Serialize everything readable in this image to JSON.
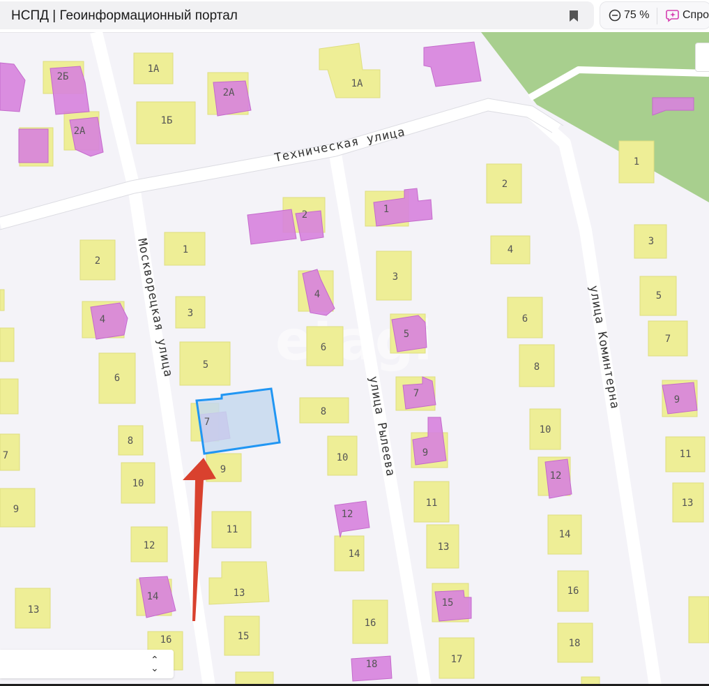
{
  "header": {
    "title": "НСПД | Геоинформационный портал",
    "zoom": "75 %",
    "ask_label": "Спро"
  },
  "icons": {
    "bookmark": "bookmark-icon",
    "zoom": "zoom-out-icon",
    "ask": "ai-assistant-icon",
    "select": "chevron-up-down-icon",
    "arrow": "arrow-up-icon"
  },
  "colors": {
    "building": "#eeee96",
    "parcel": "#d782dd",
    "selection_fill": "#c5d8ef",
    "selection_stroke": "#2196f3",
    "arrow": "#d9412e",
    "forest": "#a8cf8e",
    "road": "#ffffff"
  },
  "map": {
    "watermark": "etagi",
    "streets": {
      "tekhnicheskaya": "Техническая улица",
      "moskvoretskaya": "Москворецкая улица",
      "ryleeva": "улица Рылеева",
      "kominterna": "улица Коминтерна"
    },
    "house_numbers": {
      "h1A_left": "1А",
      "h2B": "2Б",
      "h1B": "1Б",
      "h2A_mid": "2А",
      "h2A_left": "2А",
      "h1A_right": "1А",
      "h2_mosk_w": "2",
      "h4_mosk_w": "4",
      "h6_mosk_w": "6",
      "h8_mosk_w": "8",
      "h10_mosk_w": "10",
      "h12_mosk_w": "12",
      "h14_mosk_w": "14",
      "h16_mosk_w": "16",
      "h9_far_w": "9",
      "h7_far_w": "7",
      "h13_far_w": "13",
      "h1_mosk_e": "1",
      "h3_mosk_e": "3",
      "h5_mosk_e": "5",
      "h7_mosk_e": "7",
      "h9_mosk_e": "9",
      "h11_mosk_e": "11",
      "h13_mosk_e": "13",
      "h15_mosk_e": "15",
      "h2_ryl_w": "2",
      "h4_ryl_w": "4",
      "h6_ryl_w": "6",
      "h8_ryl_w": "8",
      "h10_ryl_w": "10",
      "h12_ryl_w": "12",
      "h14_ryl_w": "14",
      "h16_ryl_w": "16",
      "h18_ryl_w": "18",
      "h1_ryl_e": "1",
      "h3_ryl_e": "3",
      "h5_ryl_e": "5",
      "h7_ryl_e": "7",
      "h9_ryl_e": "9",
      "h11_ryl_e": "11",
      "h13_ryl_e": "13",
      "h15_ryl_e": "15",
      "h17_ryl_e": "17",
      "h2_kom_w": "2",
      "h4_kom_w": "4",
      "h6_kom_w": "6",
      "h8_kom_w": "8",
      "h10_kom_w": "10",
      "h12_kom_w": "12",
      "h14_kom_w": "14",
      "h16_kom_w": "16",
      "h18_kom_w": "18",
      "h1_kom_e": "1",
      "h3_kom_e": "3",
      "h5_kom_e": "5",
      "h7_kom_e": "7",
      "h9_kom_e": "9",
      "h11_kom_e": "11",
      "h13_kom_e": "13"
    }
  }
}
